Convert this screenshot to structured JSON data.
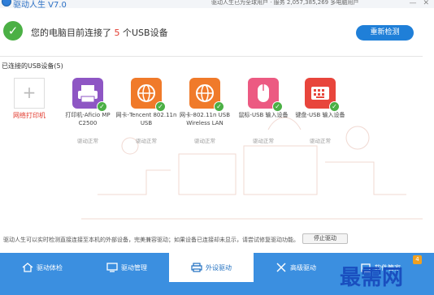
{
  "window": {
    "title": "驱动人生 V7.0",
    "info": "驱动人生已为全球用户 · 服务 2,057,385,269 多电脑用户",
    "minimize_glyph": "—",
    "close_glyph": "✕"
  },
  "status": {
    "prefix": "您的电脑目前连接了",
    "count": "5",
    "suffix": "个USB设备",
    "rescan_label": "重新检测"
  },
  "section": {
    "title": "已连接的USB设备(5)"
  },
  "add_device": {
    "plus": "+",
    "label": "网络打印机"
  },
  "devices": [
    {
      "name": "打印机-Aficio MP C2500",
      "state": "驱动正常",
      "color": "#8e56c4",
      "icon": "printer-icon"
    },
    {
      "name": "网卡-Tencent 802.11n USB",
      "state": "驱动正常",
      "color": "#f07a2a",
      "icon": "globe-icon"
    },
    {
      "name": "网卡-802.11n USB Wireless LAN",
      "state": "驱动正常",
      "color": "#f07a2a",
      "icon": "globe-icon"
    },
    {
      "name": "鼠标-USB 输入设备",
      "state": "驱动正常",
      "color": "#ec5a82",
      "icon": "mouse-icon"
    },
    {
      "name": "键盘-USB 输入设备",
      "state": "驱动正常",
      "color": "#e8453c",
      "icon": "keyboard-icon"
    }
  ],
  "footer": {
    "text": "驱动人生可以实时检测直接连接至本机的外部设备，完美兼容驱动；如果设备已连接却未显示，请尝试修复驱动功能。",
    "stop_label": "停止驱动"
  },
  "tabs": [
    {
      "label": "驱动体检",
      "icon": "home-icon"
    },
    {
      "label": "驱动管理",
      "icon": "monitor-icon"
    },
    {
      "label": "外设驱动",
      "icon": "printer-icon",
      "active": true
    },
    {
      "label": "高级驱动",
      "icon": "tools-icon"
    },
    {
      "label": "软件管家",
      "icon": "box-icon"
    }
  ],
  "corner": {
    "logo": "最需网",
    "badge": "4"
  },
  "colors": {
    "accent": "#1f7fd8",
    "ok": "#4bb045",
    "warn": "#e23a2e",
    "bar": "#3b8fe0"
  }
}
